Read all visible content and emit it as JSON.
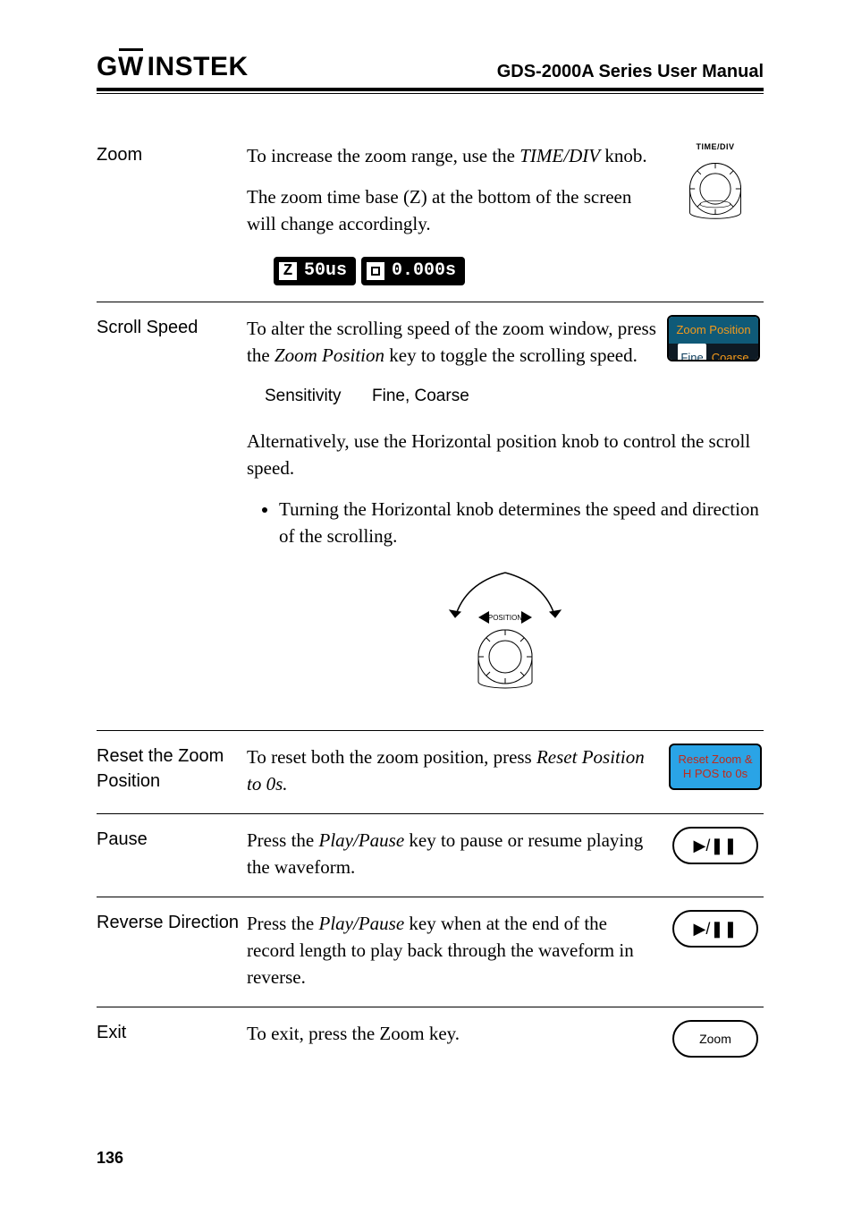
{
  "brand": "GWINSTEK",
  "header_title": "GDS-2000A Series User Manual",
  "page_number": "136",
  "sections": {
    "zoom": {
      "label": "Zoom",
      "p1a": "To increase the zoom range, use the ",
      "p1b": "TIME/DIV",
      "p1c": " knob.",
      "p2": "The zoom time base (Z) at the bottom of the screen will change accordingly.",
      "readout_z": "Z",
      "readout_zval": "50us",
      "readout_hval": "0.000s",
      "knob_label": "TIME/DIV"
    },
    "scroll": {
      "label": "Scroll Speed",
      "p1a": "To alter the scrolling speed of the zoom window, press the ",
      "p1b": "Zoom Position",
      "p1c": " key to toggle the scrolling speed.",
      "sens_label": "Sensitivity",
      "sens_val": "Fine, Coarse",
      "p2": "Alternatively, use the Horizontal position knob to control the scroll speed.",
      "li1": "Turning the Horizontal knob determines the speed and direction of the scrolling.",
      "softkey_top": "Zoom Position",
      "softkey_fine": "Fine",
      "softkey_coarse": "Coarse",
      "pos_label": "POSITION"
    },
    "reset": {
      "label": "Reset the Zoom Position",
      "p1a": "To reset both the zoom position, press ",
      "p1b": "Reset Position to 0s.",
      "softkey_l1": "Reset Zoom &",
      "softkey_l2": "H POS to 0s"
    },
    "pause": {
      "label": "Pause",
      "p1a": "Press the ",
      "p1b": "Play/Pause",
      "p1c": " key to pause or resume playing the waveform.",
      "btn": "▶/❚❚"
    },
    "reverse": {
      "label": "Reverse Direction",
      "p1a": "Press the ",
      "p1b": "Play/Pause",
      "p1c": " key when at the end of the record length to play back through the waveform in reverse.",
      "btn": "▶/❚❚"
    },
    "exit": {
      "label": "Exit",
      "p1": "To exit, press the Zoom key.",
      "btn": "Zoom"
    }
  }
}
